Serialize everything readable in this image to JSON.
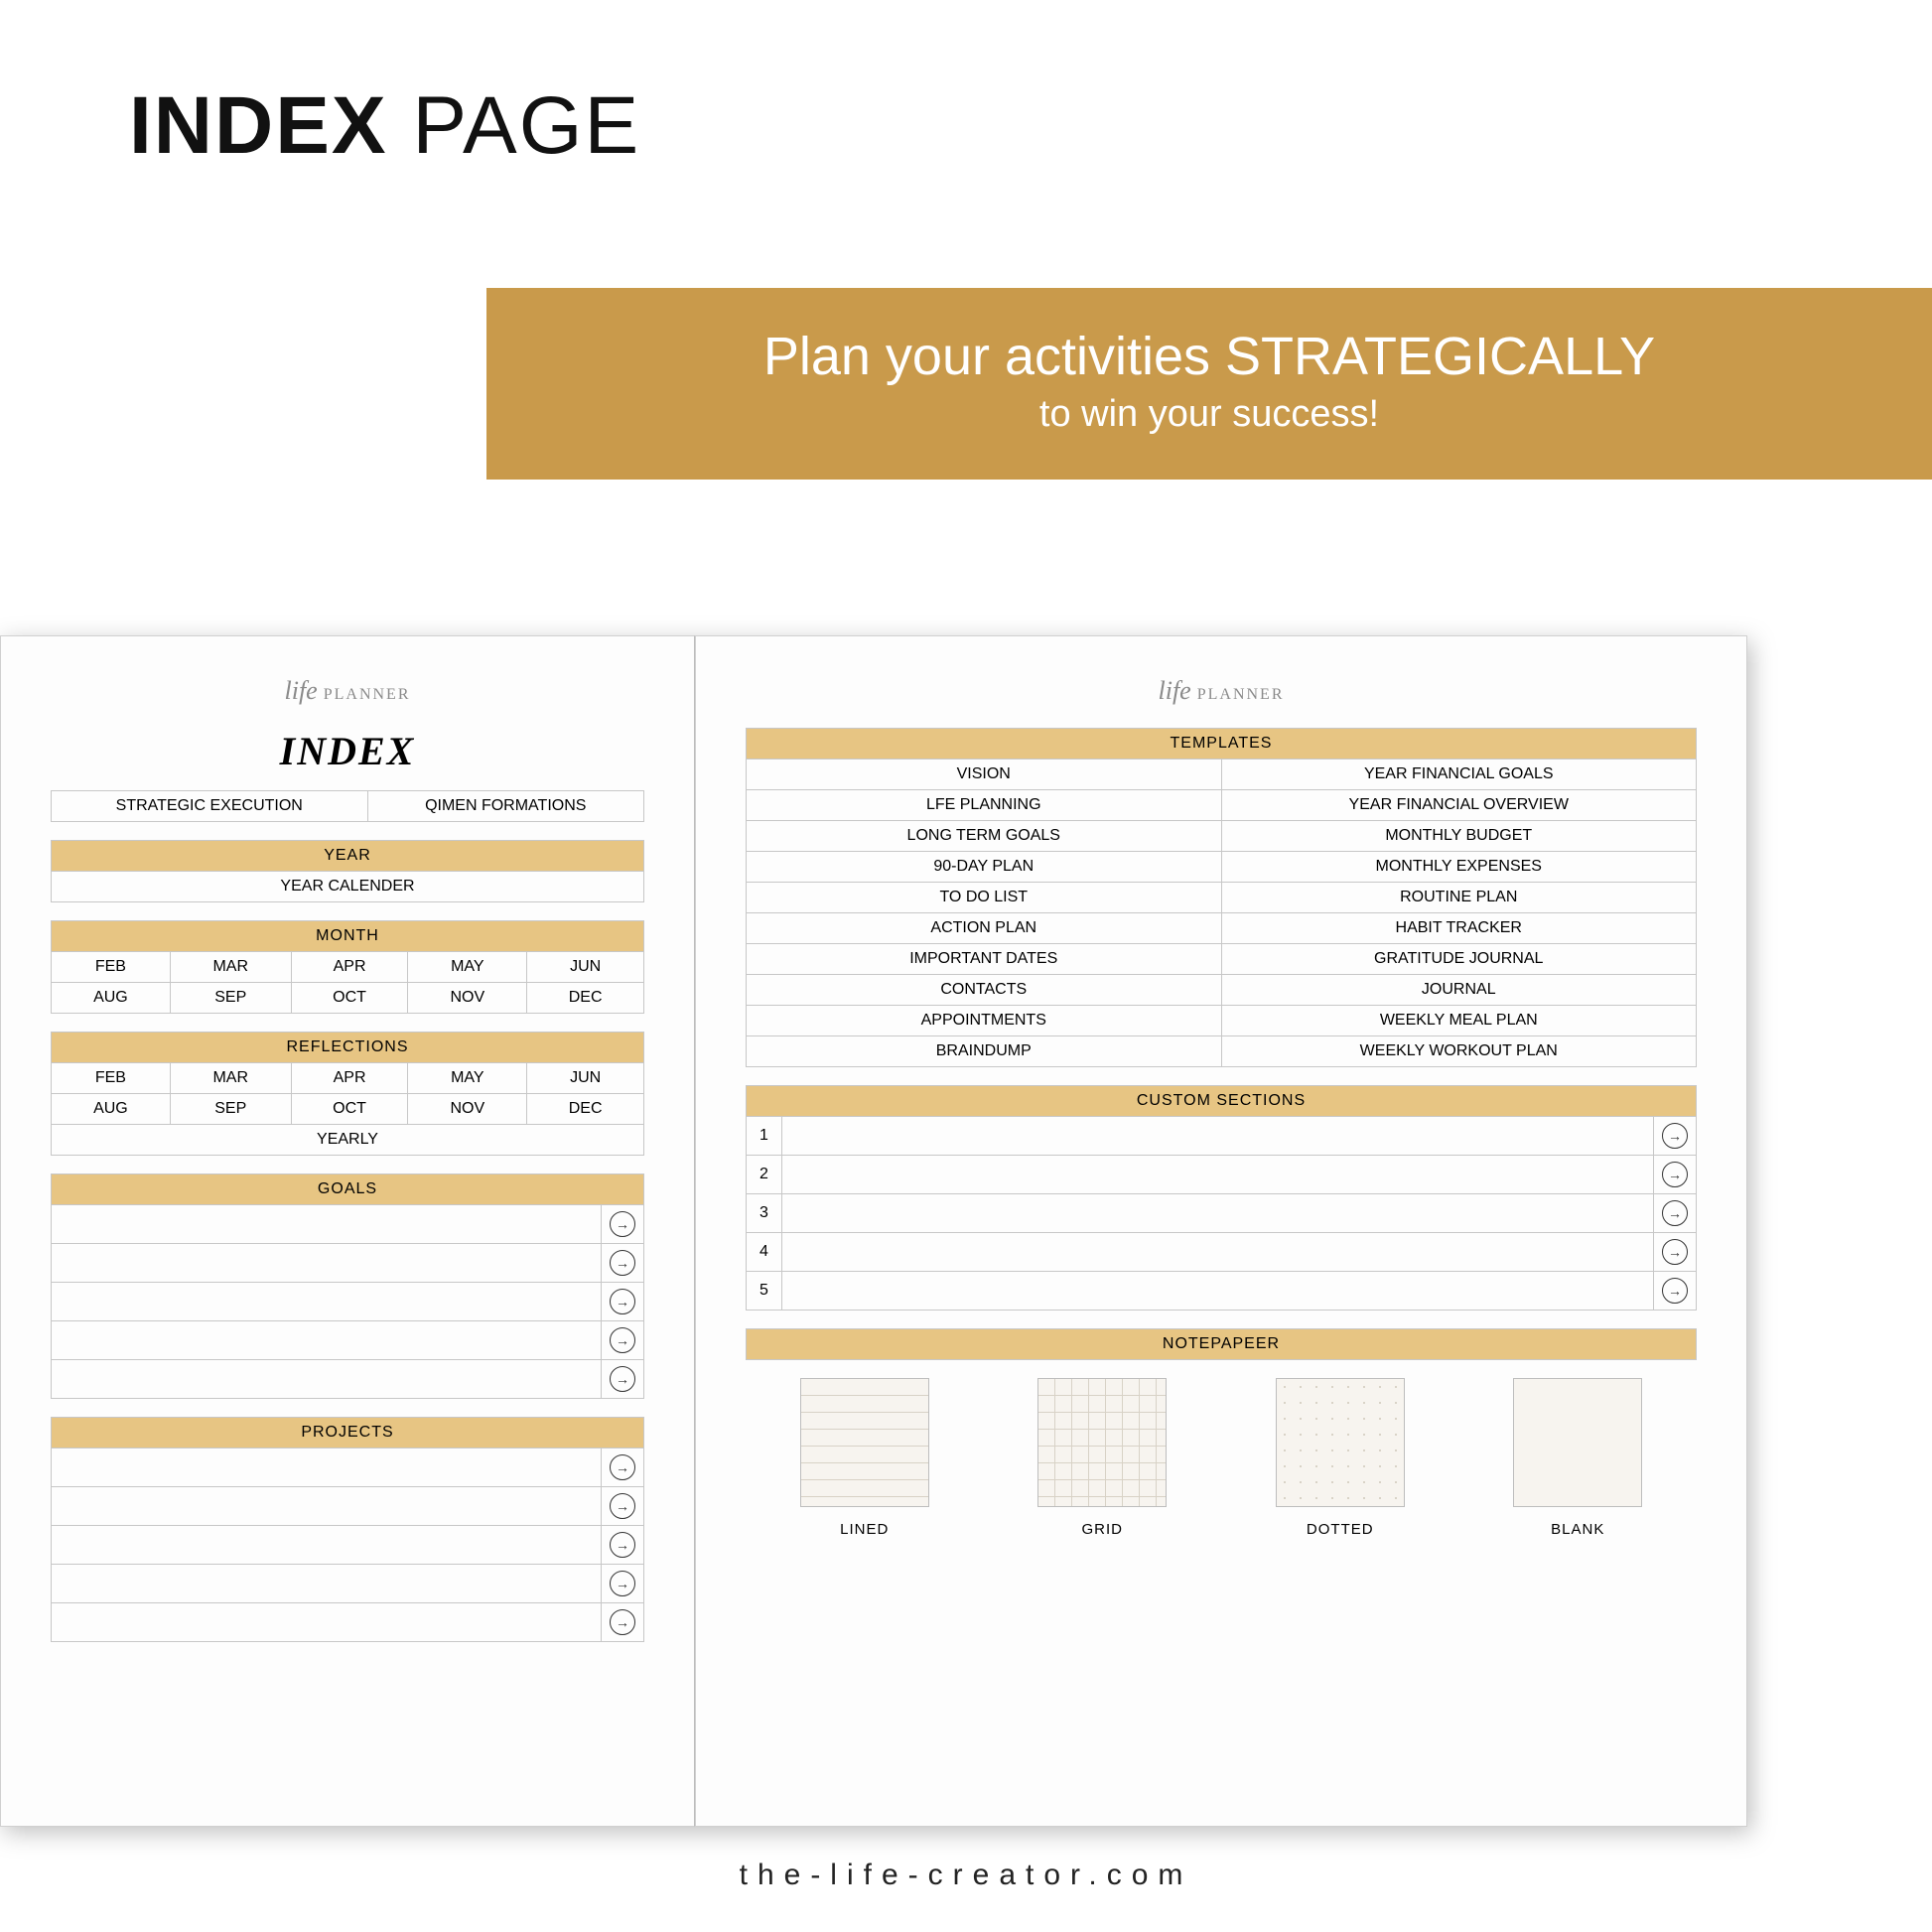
{
  "header": {
    "title_bold": "INDEX",
    "title_thin": " PAGE"
  },
  "banner": {
    "line1": "Plan your activities STRATEGICALLY",
    "line2": "to win your success!"
  },
  "logo": {
    "script": "life",
    "caps": " PLANNER"
  },
  "left": {
    "index_title": "INDEX",
    "top_row": [
      "STRATEGIC EXECUTION",
      "QIMEN FORMATIONS"
    ],
    "year_hdr": "YEAR",
    "year_row": "YEAR CALENDER",
    "month_hdr": "MONTH",
    "months1": [
      "FEB",
      "MAR",
      "APR",
      "MAY",
      "JUN"
    ],
    "months2": [
      "AUG",
      "SEP",
      "OCT",
      "NOV",
      "DEC"
    ],
    "refl_hdr": "REFLECTIONS",
    "refl_yearly": "YEARLY",
    "goals_hdr": "GOALS",
    "projects_hdr": "PROJECTS"
  },
  "right": {
    "templates_hdr": "TEMPLATES",
    "templates": [
      [
        "VISION",
        "YEAR FINANCIAL GOALS"
      ],
      [
        "LFE PLANNING",
        "YEAR FINANCIAL OVERVIEW"
      ],
      [
        "LONG TERM GOALS",
        "MONTHLY BUDGET"
      ],
      [
        "90-DAY PLAN",
        "MONTHLY EXPENSES"
      ],
      [
        "TO DO LIST",
        "ROUTINE PLAN"
      ],
      [
        "ACTION PLAN",
        "HABIT TRACKER"
      ],
      [
        "IMPORTANT DATES",
        "GRATITUDE JOURNAL"
      ],
      [
        "CONTACTS",
        "JOURNAL"
      ],
      [
        "APPOINTMENTS",
        "WEEKLY MEAL PLAN"
      ],
      [
        "BRAINDUMP",
        "WEEKLY WORKOUT PLAN"
      ]
    ],
    "custom_hdr": "CUSTOM SECTIONS",
    "custom_nums": [
      "1",
      "2",
      "3",
      "4",
      "5"
    ],
    "notepaper_hdr": "NOTEPAPEER",
    "notepaper": [
      "LINED",
      "GRID",
      "DOTTED",
      "BLANK"
    ]
  },
  "footer": "the-life-creator.com"
}
